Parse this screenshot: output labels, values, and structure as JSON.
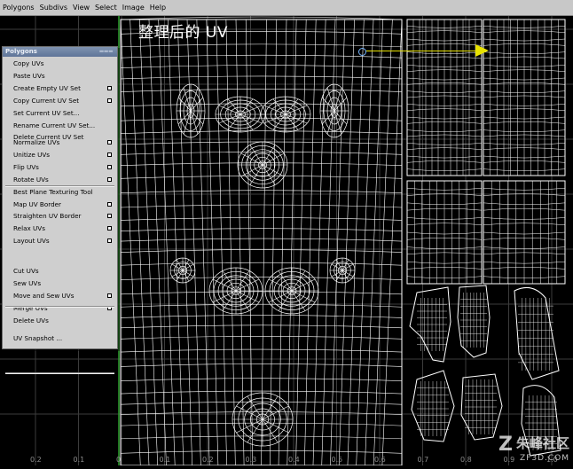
{
  "menubar": {
    "items": [
      "Polygons",
      "Subdivs",
      "View",
      "Select",
      "Image",
      "Help"
    ]
  },
  "caption": "整理后的 UV",
  "polygons_menu": {
    "title": "Polygons",
    "groups": [
      [
        {
          "label": "Copy UVs",
          "option": false
        },
        {
          "label": "Paste UVs",
          "option": false
        },
        {
          "label": "Create Empty UV Set",
          "option": true
        },
        {
          "label": "Copy Current UV Set",
          "option": true
        },
        {
          "label": "Set Current UV Set...",
          "option": false
        },
        {
          "label": "Rename Current UV Set...",
          "option": false
        },
        {
          "label": "Delete Current UV Set",
          "option": false
        }
      ],
      [
        {
          "label": "Normalize UVs",
          "option": true
        },
        {
          "label": "Unitize UVs",
          "option": true
        },
        {
          "label": "Flip UVs",
          "option": true
        },
        {
          "label": "Rotate UVs",
          "option": true
        },
        {
          "label": "Best Plane Texturing Tool",
          "option": false
        },
        {
          "label": "Map UV Border",
          "option": true
        },
        {
          "label": "Straighten UV Border",
          "option": true
        },
        {
          "label": "Relax UVs",
          "option": true
        },
        {
          "label": "Layout UVs",
          "option": true
        }
      ],
      [
        {
          "label": "Cut UVs",
          "option": false
        },
        {
          "label": "Sew UVs",
          "option": false
        },
        {
          "label": "Move and Sew UVs",
          "option": true
        },
        {
          "label": "Merge UVs",
          "option": true
        },
        {
          "label": "Delete UVs",
          "option": false
        }
      ],
      [
        {
          "label": "UV Snapshot ...",
          "option": false
        }
      ]
    ]
  },
  "axis_labels": [
    "0.2",
    "0.1",
    "0",
    "0.1",
    "0.2",
    "0.3",
    "0.4",
    "0.5",
    "0.6",
    "0.7",
    "0.8",
    "0.9",
    "1.0"
  ],
  "watermark": {
    "logo": "Z",
    "name": "朱峰社区",
    "url": "ZF3D.COM"
  },
  "colors": {
    "menubar": "#c8c8c8",
    "menu_bg": "#cfcfcf",
    "menu_title": "#6b80a3",
    "canvas_bg": "#000000",
    "grid": "#3c3c3c",
    "wire": "#ffffff",
    "arrow": "#e8e200",
    "axis_green": "#2e9f2e"
  }
}
